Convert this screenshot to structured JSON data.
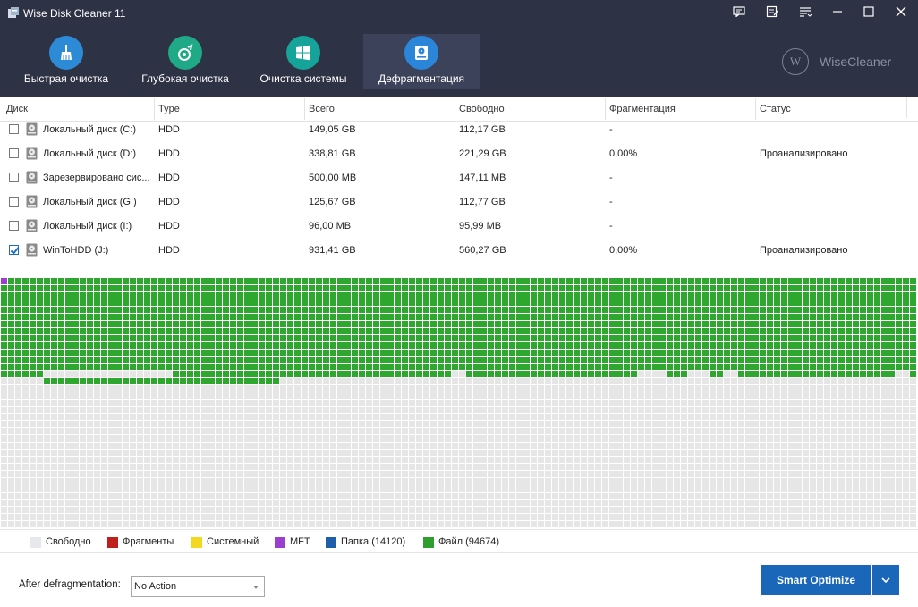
{
  "app": {
    "title": "Wise Disk Cleaner 11",
    "brand": "WiseCleaner",
    "brand_initial": "W"
  },
  "titlebar_icons": [
    "feedback-icon",
    "notes-icon",
    "menu-icon",
    "minimize-icon",
    "maximize-icon",
    "close-icon"
  ],
  "tabs": [
    {
      "label": "Быстрая очистка",
      "icon": "broom-icon",
      "color": "#2d8ad6",
      "active": false
    },
    {
      "label": "Глубокая очистка",
      "icon": "deep-clean-icon",
      "color": "#1fa986",
      "active": false
    },
    {
      "label": "Очистка системы",
      "icon": "windows-icon",
      "color": "#15a39a",
      "active": false
    },
    {
      "label": "Дефрагментация",
      "icon": "disk-defrag-icon",
      "color": "#2b86d9",
      "active": true
    }
  ],
  "table": {
    "columns": [
      "Диск",
      "Type",
      "Всего",
      "Свободно",
      "Фрагментация",
      "Статус"
    ],
    "rows": [
      {
        "name": "Локальный диск (C:)",
        "type": "HDD",
        "total": "149,05 GB",
        "free": "112,17 GB",
        "frag": "-",
        "status": "",
        "checked": false
      },
      {
        "name": "Локальный диск (D:)",
        "type": "HDD",
        "total": "338,81 GB",
        "free": "221,29 GB",
        "frag": "0,00%",
        "status": "Проанализировано",
        "checked": false
      },
      {
        "name": "Зарезервировано сис...",
        "type": "HDD",
        "total": "500,00 MB",
        "free": "147,11 MB",
        "frag": "-",
        "status": "",
        "checked": false
      },
      {
        "name": "Локальный диск (G:)",
        "type": "HDD",
        "total": "125,67 GB",
        "free": "112,77 GB",
        "frag": "-",
        "status": "",
        "checked": false
      },
      {
        "name": "Локальный диск (I:)",
        "type": "HDD",
        "total": "96,00 MB",
        "free": "95,99 MB",
        "frag": "-",
        "status": "",
        "checked": false
      },
      {
        "name": "WinToHDD (J:)",
        "type": "HDD",
        "total": "931,41 GB",
        "free": "560,27 GB",
        "frag": "0,00%",
        "status": "Проанализировано",
        "checked": true
      }
    ]
  },
  "legend": [
    {
      "label": "Свободно",
      "color": "#e6e8eb"
    },
    {
      "label": "Фрагменты",
      "color": "#c0201b"
    },
    {
      "label": "Системный",
      "color": "#f4d820"
    },
    {
      "label": "MFT",
      "color": "#9a3fd0"
    },
    {
      "label": "Папка (14120)",
      "color": "#1f5faa"
    },
    {
      "label": "Файл (94674)",
      "color": "#2e9f2e"
    }
  ],
  "map_colors": {
    "file": "#2ea72e",
    "free": "#e6e6e6",
    "mft": "#9a3fd0"
  },
  "bottom": {
    "after_label": "After defragmentation:",
    "select_value": "No Action",
    "button_label": "Smart Optimize"
  }
}
